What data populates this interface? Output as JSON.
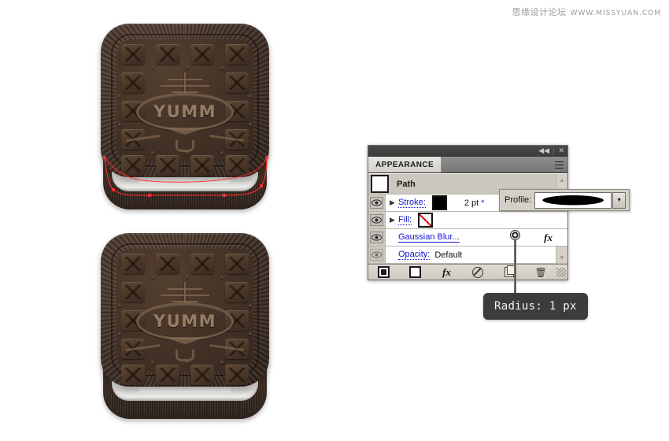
{
  "watermark": {
    "cn": "思缘设计论坛",
    "en": "WWW.MISSYUAN.COM"
  },
  "artwork": {
    "cookie_brand": "YUMM",
    "top_cookie_name": "cookie-with-selection-path",
    "bottom_cookie_name": "cookie-final"
  },
  "panel": {
    "tab_label": "APPEARANCE",
    "collapse_icon": "◀◀",
    "close_icon": "✕",
    "menu_icon": "panel-menu-icon",
    "rows": [
      {
        "label": "Path",
        "type": "header"
      },
      {
        "label": "Stroke:",
        "value": "2 pt",
        "modifier": "*",
        "type": "stroke"
      },
      {
        "label": "Fill:",
        "value": "",
        "type": "fill"
      },
      {
        "label": "Gaussian Blur...",
        "value": "",
        "type": "effect",
        "fx": "fx"
      },
      {
        "label": "Opacity:",
        "value": "Default",
        "type": "opacity"
      }
    ],
    "toolbar": [
      {
        "name": "add-new-stroke-button",
        "icon": "filled-square"
      },
      {
        "name": "add-new-fill-button",
        "icon": "empty-square"
      },
      {
        "name": "add-new-effect-button",
        "icon": "fx"
      },
      {
        "name": "clear-appearance-button",
        "icon": "no-symbol"
      },
      {
        "name": "duplicate-item-button",
        "icon": "duplicate"
      },
      {
        "name": "delete-item-button",
        "icon": "trash"
      }
    ],
    "scroll_up_icon": "▲",
    "scroll_down_icon": "▼"
  },
  "profile_popup": {
    "label": "Profile:",
    "selected_profile": "width-profile-1-lens",
    "dropdown_icon": "▼"
  },
  "tooltip": {
    "text": "Radius: 1 px"
  },
  "colors": {
    "panel_face": "#d4d0c8",
    "panel_body": "#ffffff",
    "link_blue": "#1414cf",
    "path_red": "#ff2d2d",
    "tooltip_bg": "#3c3c3c",
    "cookie_dark": "#3a2b22",
    "cream_white": "#f4f4f2"
  }
}
